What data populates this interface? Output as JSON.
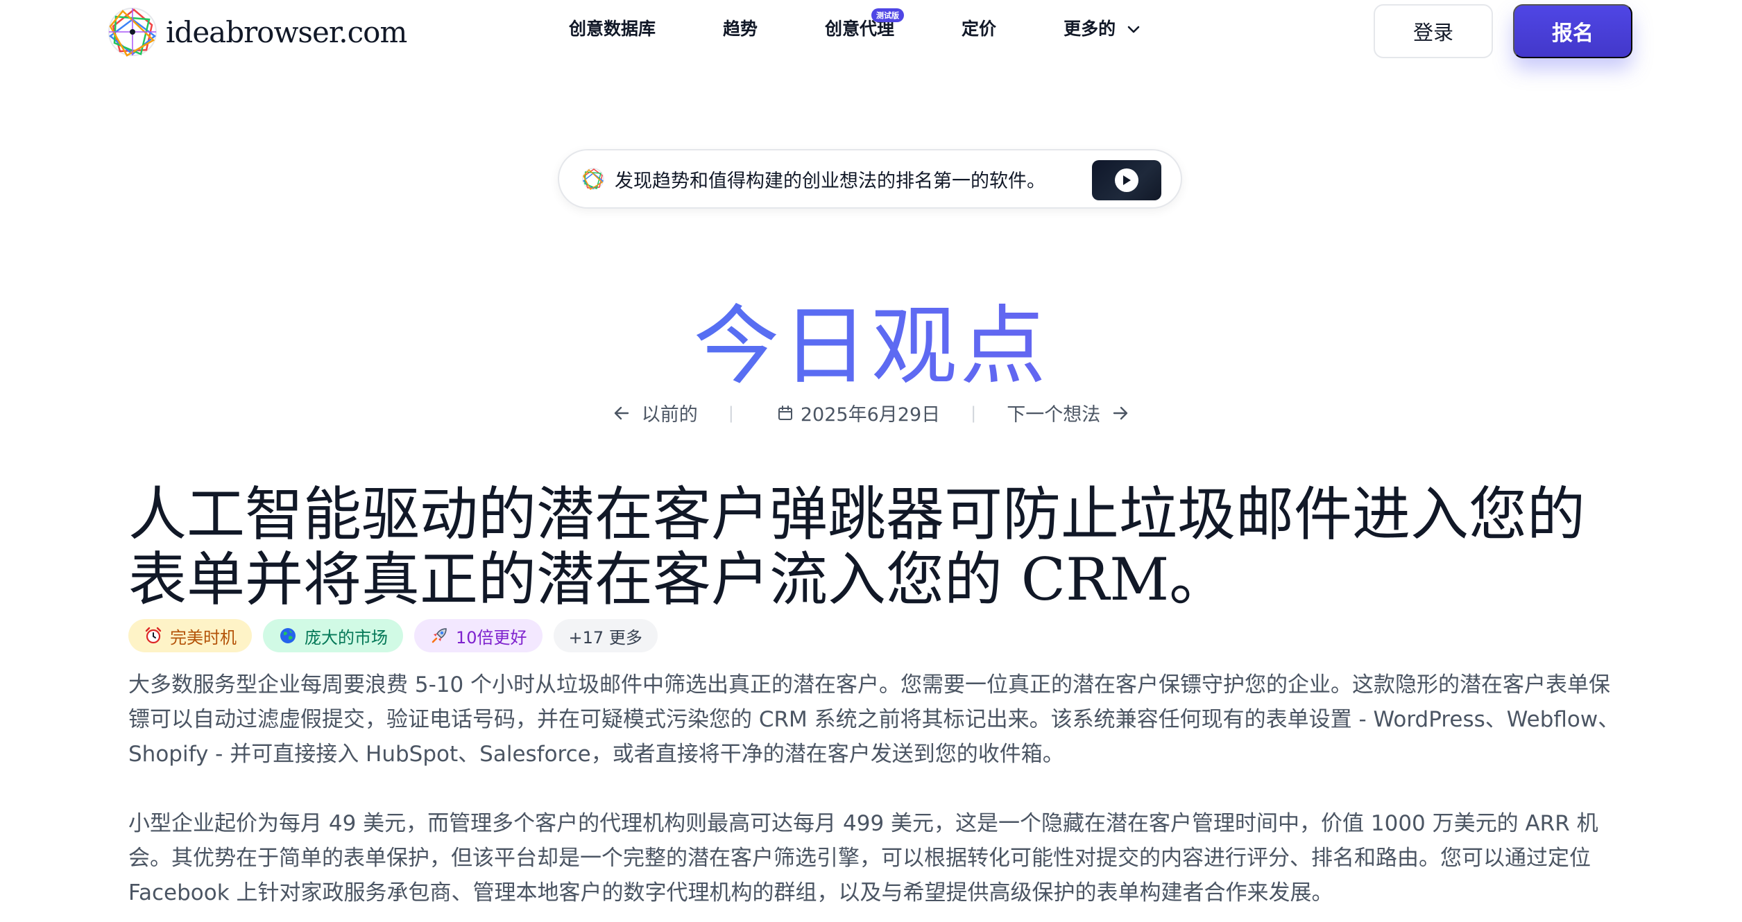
{
  "brand": {
    "name": "ideabrowser.com"
  },
  "nav": {
    "items": [
      {
        "label": "创意数据库"
      },
      {
        "label": "趋势"
      },
      {
        "label": "创意代理",
        "badge": "测试版"
      },
      {
        "label": "定价"
      },
      {
        "label": "更多的"
      }
    ],
    "login_label": "登录",
    "signup_label": "报名"
  },
  "announcement": {
    "text": "发现趋势和值得构建的创业想法的排名第一的软件。"
  },
  "hero": {
    "title": "今日观点"
  },
  "idea_nav": {
    "prev_label": "以前的",
    "date": "2025年6月29日",
    "next_label": "下一个想法"
  },
  "idea": {
    "title": "人工智能驱动的潜在客户弹跳器可防止垃圾邮件进入您的表单并将真正的潜在客户流入您的 CRM。",
    "tags": [
      {
        "label": "完美时机",
        "icon": "alarm-clock-icon"
      },
      {
        "label": "庞大的市场",
        "icon": "globe-icon"
      },
      {
        "label": "10倍更好",
        "icon": "rocket-icon"
      }
    ],
    "more_tags_label": "+17 更多",
    "paragraphs": [
      "大多数服务型企业每周要浪费 5-10 个小时从垃圾邮件中筛选出真正的潜在客户。您需要一位真正的潜在客户保镖守护您的企业。这款隐形的潜在客户表单保镖可以自动过滤虚假提交，验证电话号码，并在可疑模式污染您的 CRM 系统之前将其标记出来。该系统兼容任何现有的表单设置 - WordPress、Webflow、Shopify - 并可直接接入 HubSpot、Salesforce，或者直接将干净的潜在客户发送到您的收件箱。",
      "小型企业起价为每月 49 美元，而管理多个客户的代理机构则最高可达每月 499 美元，这是一个隐藏在潜在客户管理时间中，价值 1000 万美元的 ARR 机会。其优势在于简单的表单保护，但该平台却是一个完整的潜在客户筛选引擎，可以根据转化可能性对提交的内容进行评分、排名和路由。您可以通过定位 Facebook 上针对家政服务承包商、管理本地客户的数字代理机构的群组，以及与希望提供高级保护的表单构建者合作来发展。"
    ]
  },
  "colors": {
    "accent": "#4f46e5",
    "hero_gradient_start": "#3b82f6",
    "hero_gradient_end": "#7c3aed",
    "tag_timing_bg": "#fef3c7",
    "tag_market_bg": "#d1fae5",
    "tag_better_bg": "#f3e8ff"
  }
}
